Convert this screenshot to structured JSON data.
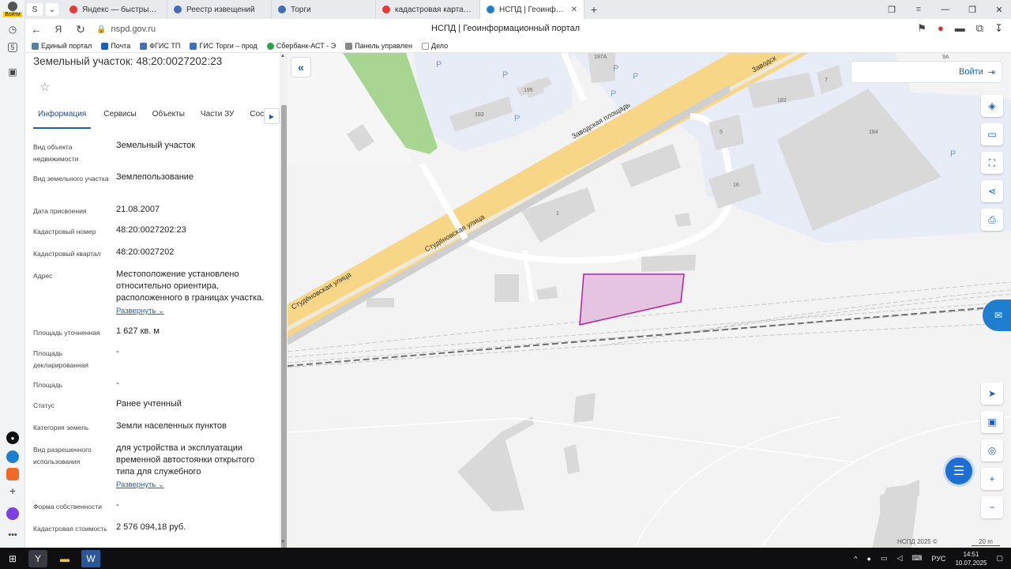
{
  "browser": {
    "login_label": "Войти",
    "tabs": [
      {
        "title": "Яндекс — быстрый поиск",
        "color": "#e53935"
      },
      {
        "title": "Реестр извещений",
        "color": "#3f6fb5"
      },
      {
        "title": "Торги",
        "color": "#3f6fb5"
      },
      {
        "title": "кадастровая карта — Янд",
        "color": "#e53935"
      },
      {
        "title": "НСПД | Геоинформацио",
        "color": "#1e7fd1"
      }
    ],
    "url": "nspd.gov.ru",
    "page_title": "НСПД | Геоинформационный портал",
    "bookmarks": [
      {
        "label": "Единый портал",
        "color": "#5a7fa8"
      },
      {
        "label": "Почта",
        "color": "#1e5fb5"
      },
      {
        "label": "ФГИС ТП",
        "color": "#3f6fb5"
      },
      {
        "label": "ГИС Торги – прод",
        "color": "#3f6fb5"
      },
      {
        "label": "Сбербанк-АСТ - Э",
        "color": "#2e9e4f"
      },
      {
        "label": "Панель управлен",
        "color": "#888888"
      },
      {
        "label": "Дело",
        "color": "#bbbbbb"
      }
    ]
  },
  "panel": {
    "title": "Земельный участок: 48:20:0027202:23",
    "tabs": [
      "Информация",
      "Сервисы",
      "Объекты",
      "Части ЗУ",
      "Соста"
    ],
    "expand_label": "Развернуть",
    "rows": [
      {
        "key": "Вид объекта недвижимости",
        "value": "Земельный участок"
      },
      {
        "key": "Вид земельного участка",
        "value": "Землепользование"
      },
      {
        "key": "Дата присвоения",
        "value": "21.08.2007"
      },
      {
        "key": "Кадастровый номер",
        "value": "48:20:0027202:23"
      },
      {
        "key": "Кадастровый квартал",
        "value": "48:20:0027202"
      },
      {
        "key": "Адрес",
        "value": "Местоположение установлено относительно ориентира, расположенного в границах участка.",
        "expand": true
      },
      {
        "key": "Площадь уточненная",
        "value": "1 627 кв. м"
      },
      {
        "key": "Площадь декларированная",
        "value": "-"
      },
      {
        "key": "Площадь",
        "value": "-"
      },
      {
        "key": "Статус",
        "value": "Ранее учтенный"
      },
      {
        "key": "Категория земель",
        "value": "Земли населенных пунктов"
      },
      {
        "key": "Вид разрешенного использования",
        "value": "для устройства и эксплуатации временной автостоянки открытого типа для служебного",
        "expand": true
      },
      {
        "key": "Форма собственности",
        "value": "-"
      },
      {
        "key": "Кадастровая стоимость",
        "value": "2 576 094,18 руб."
      }
    ]
  },
  "map": {
    "login_label": "Войти",
    "street_labels": [
      "Заводская площадь",
      "Студёновская улица",
      "Заводск"
    ],
    "building_labels": [
      "197А",
      "195",
      "193",
      "182",
      "184",
      "7",
      "9А",
      "5",
      "16",
      "1"
    ],
    "parking_label": "P",
    "copyright": "НСПД 2025 ©",
    "scale_label": "20 m",
    "parcel_color": "#b3219b",
    "accent": "#1e5fb5"
  },
  "taskbar": {
    "lang": "РУС",
    "time": "14:51",
    "date": "10.07.2025"
  }
}
